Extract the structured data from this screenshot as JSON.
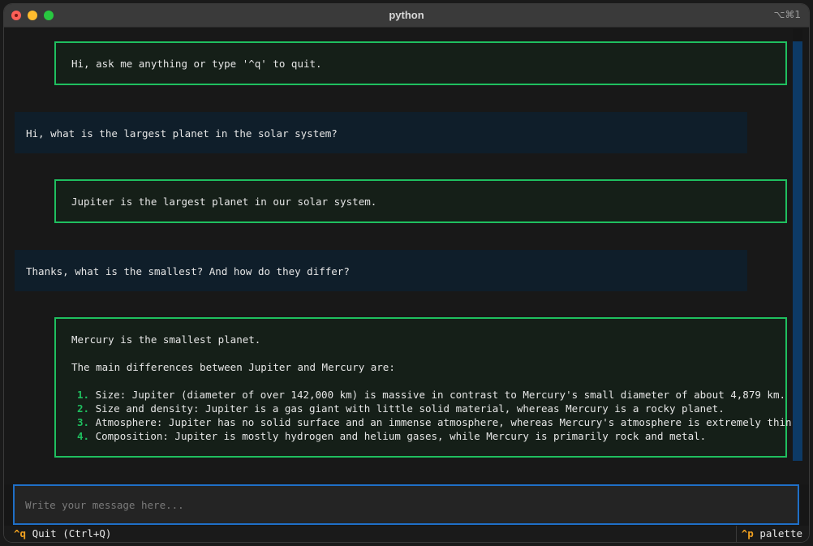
{
  "window": {
    "title": "python",
    "shortcut": "⌥⌘1"
  },
  "messages": [
    {
      "role": "assistant",
      "lines": [
        "Hi, ask me anything or type '^q' to quit."
      ]
    },
    {
      "role": "user",
      "text": "Hi, what is the largest planet in the solar system?"
    },
    {
      "role": "assistant",
      "lines": [
        "Jupiter is the largest planet in our solar system."
      ]
    },
    {
      "role": "user",
      "text": "Thanks, what is the smallest? And how do they differ?"
    },
    {
      "role": "assistant",
      "intro": "Mercury is the smallest planet.",
      "lead": "The main differences between Jupiter and Mercury are:",
      "list": [
        {
          "num": "1.",
          "text": "Size: Jupiter (diameter of over 142,000 km) is massive in contrast to Mercury's small diameter of about 4,879 km."
        },
        {
          "num": "2.",
          "text": "Size and density: Jupiter is a gas giant with little solid material, whereas Mercury is a rocky planet."
        },
        {
          "num": "3.",
          "text": "Atmosphere: Jupiter has no solid surface and an immense atmosphere, whereas Mercury's atmosphere is extremely thin."
        },
        {
          "num": "4.",
          "text": "Composition: Jupiter is mostly hydrogen and helium gases, while Mercury is primarily rock and metal."
        }
      ]
    }
  ],
  "input": {
    "placeholder": "Write your message here...",
    "value": ""
  },
  "footer": {
    "quit_key": "^q",
    "quit_label": "Quit (Ctrl+Q)",
    "palette_key": "^p",
    "palette_label": "palette"
  },
  "colors": {
    "accent_green": "#1fbf5f",
    "accent_blue": "#1f6fc7",
    "key_orange": "#f0a020"
  }
}
